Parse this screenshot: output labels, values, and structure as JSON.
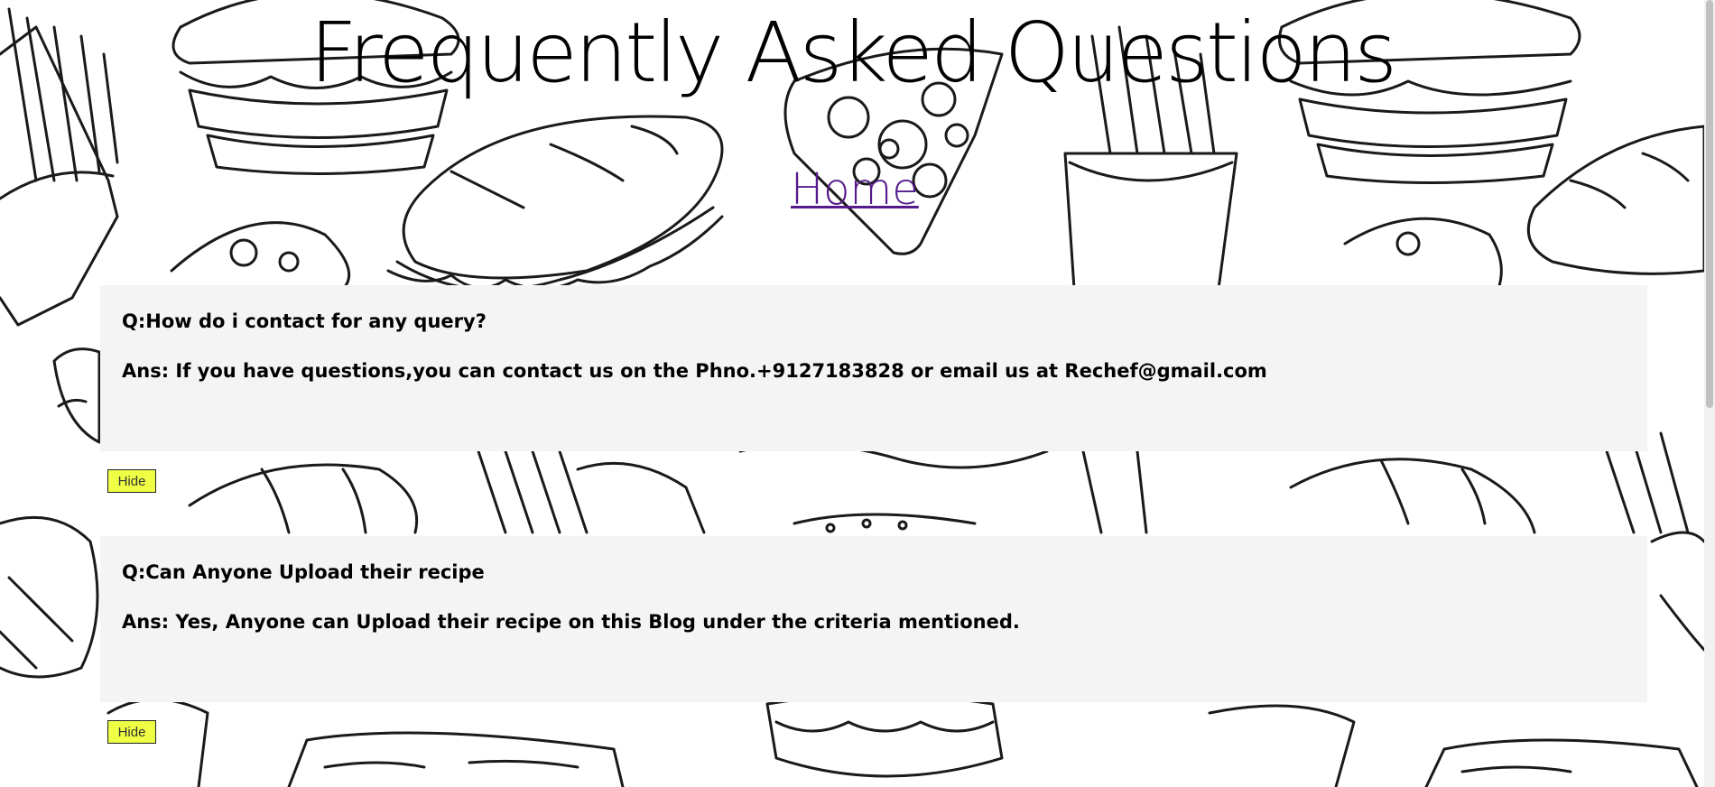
{
  "page": {
    "title": "Frequently Asked Questions",
    "home_link": "Home"
  },
  "faqs": [
    {
      "question": "Q:How do i contact for any query?",
      "answer": "Ans: If you have questions,you can contact us on the Phno.+9127183828 or email us at Rechef@gmail.com",
      "hide_label": "Hide"
    },
    {
      "question": "Q:Can Anyone Upload their recipe",
      "answer": "Ans: Yes, Anyone can Upload their recipe on this Blog under the criteria mentioned.",
      "hide_label": "Hide"
    }
  ],
  "colors": {
    "card_background": "#f4f4f4",
    "hide_button": "#eeff44",
    "link": "#551a8b"
  }
}
